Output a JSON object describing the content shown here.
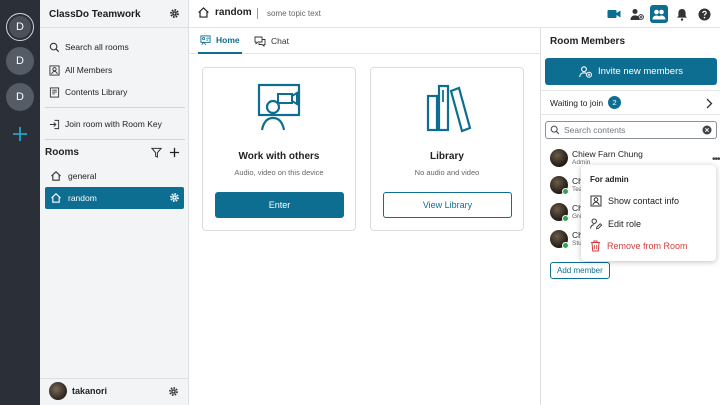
{
  "workspaces": [
    "D",
    "D",
    "D"
  ],
  "sidebar": {
    "workspace_name": "ClassDo Teamwork",
    "items": [
      {
        "label": "Search all rooms"
      },
      {
        "label": "All Members"
      },
      {
        "label": "Contents Library"
      },
      {
        "label": "Join room with Room Key"
      }
    ],
    "rooms_title": "Rooms",
    "rooms": [
      {
        "name": "general"
      },
      {
        "name": "random"
      }
    ],
    "user_name": "takanori"
  },
  "topbar": {
    "room_name": "random",
    "topic": "some topic text"
  },
  "tabs": [
    {
      "label": "Home"
    },
    {
      "label": "Chat"
    }
  ],
  "cards": [
    {
      "title": "Work with others",
      "subtitle": "Audio, video on this device",
      "button": "Enter"
    },
    {
      "title": "Library",
      "subtitle": "No audio and video",
      "button": "View Library"
    }
  ],
  "panel": {
    "title": "Room Members",
    "invite_label": "Invite new members",
    "waiting_label": "Waiting to join",
    "waiting_count": "2",
    "search_placeholder": "Search contents",
    "members": [
      {
        "name": "Chiew Farn Chung",
        "role": "Admin"
      },
      {
        "name": "Ch",
        "role": "Tea"
      },
      {
        "name": "Ch",
        "role": "Gre"
      },
      {
        "name": "Ch",
        "role": "Stu"
      }
    ],
    "add_member_label": "Add member"
  },
  "context_menu": {
    "header": "For admin",
    "items": [
      {
        "label": "Show contact info"
      },
      {
        "label": "Edit role"
      },
      {
        "label": "Remove from Room"
      }
    ]
  },
  "colors": {
    "accent": "#0e6e91",
    "rail": "#2b3038",
    "danger": "#d43c3c",
    "online": "#2ea54f"
  }
}
